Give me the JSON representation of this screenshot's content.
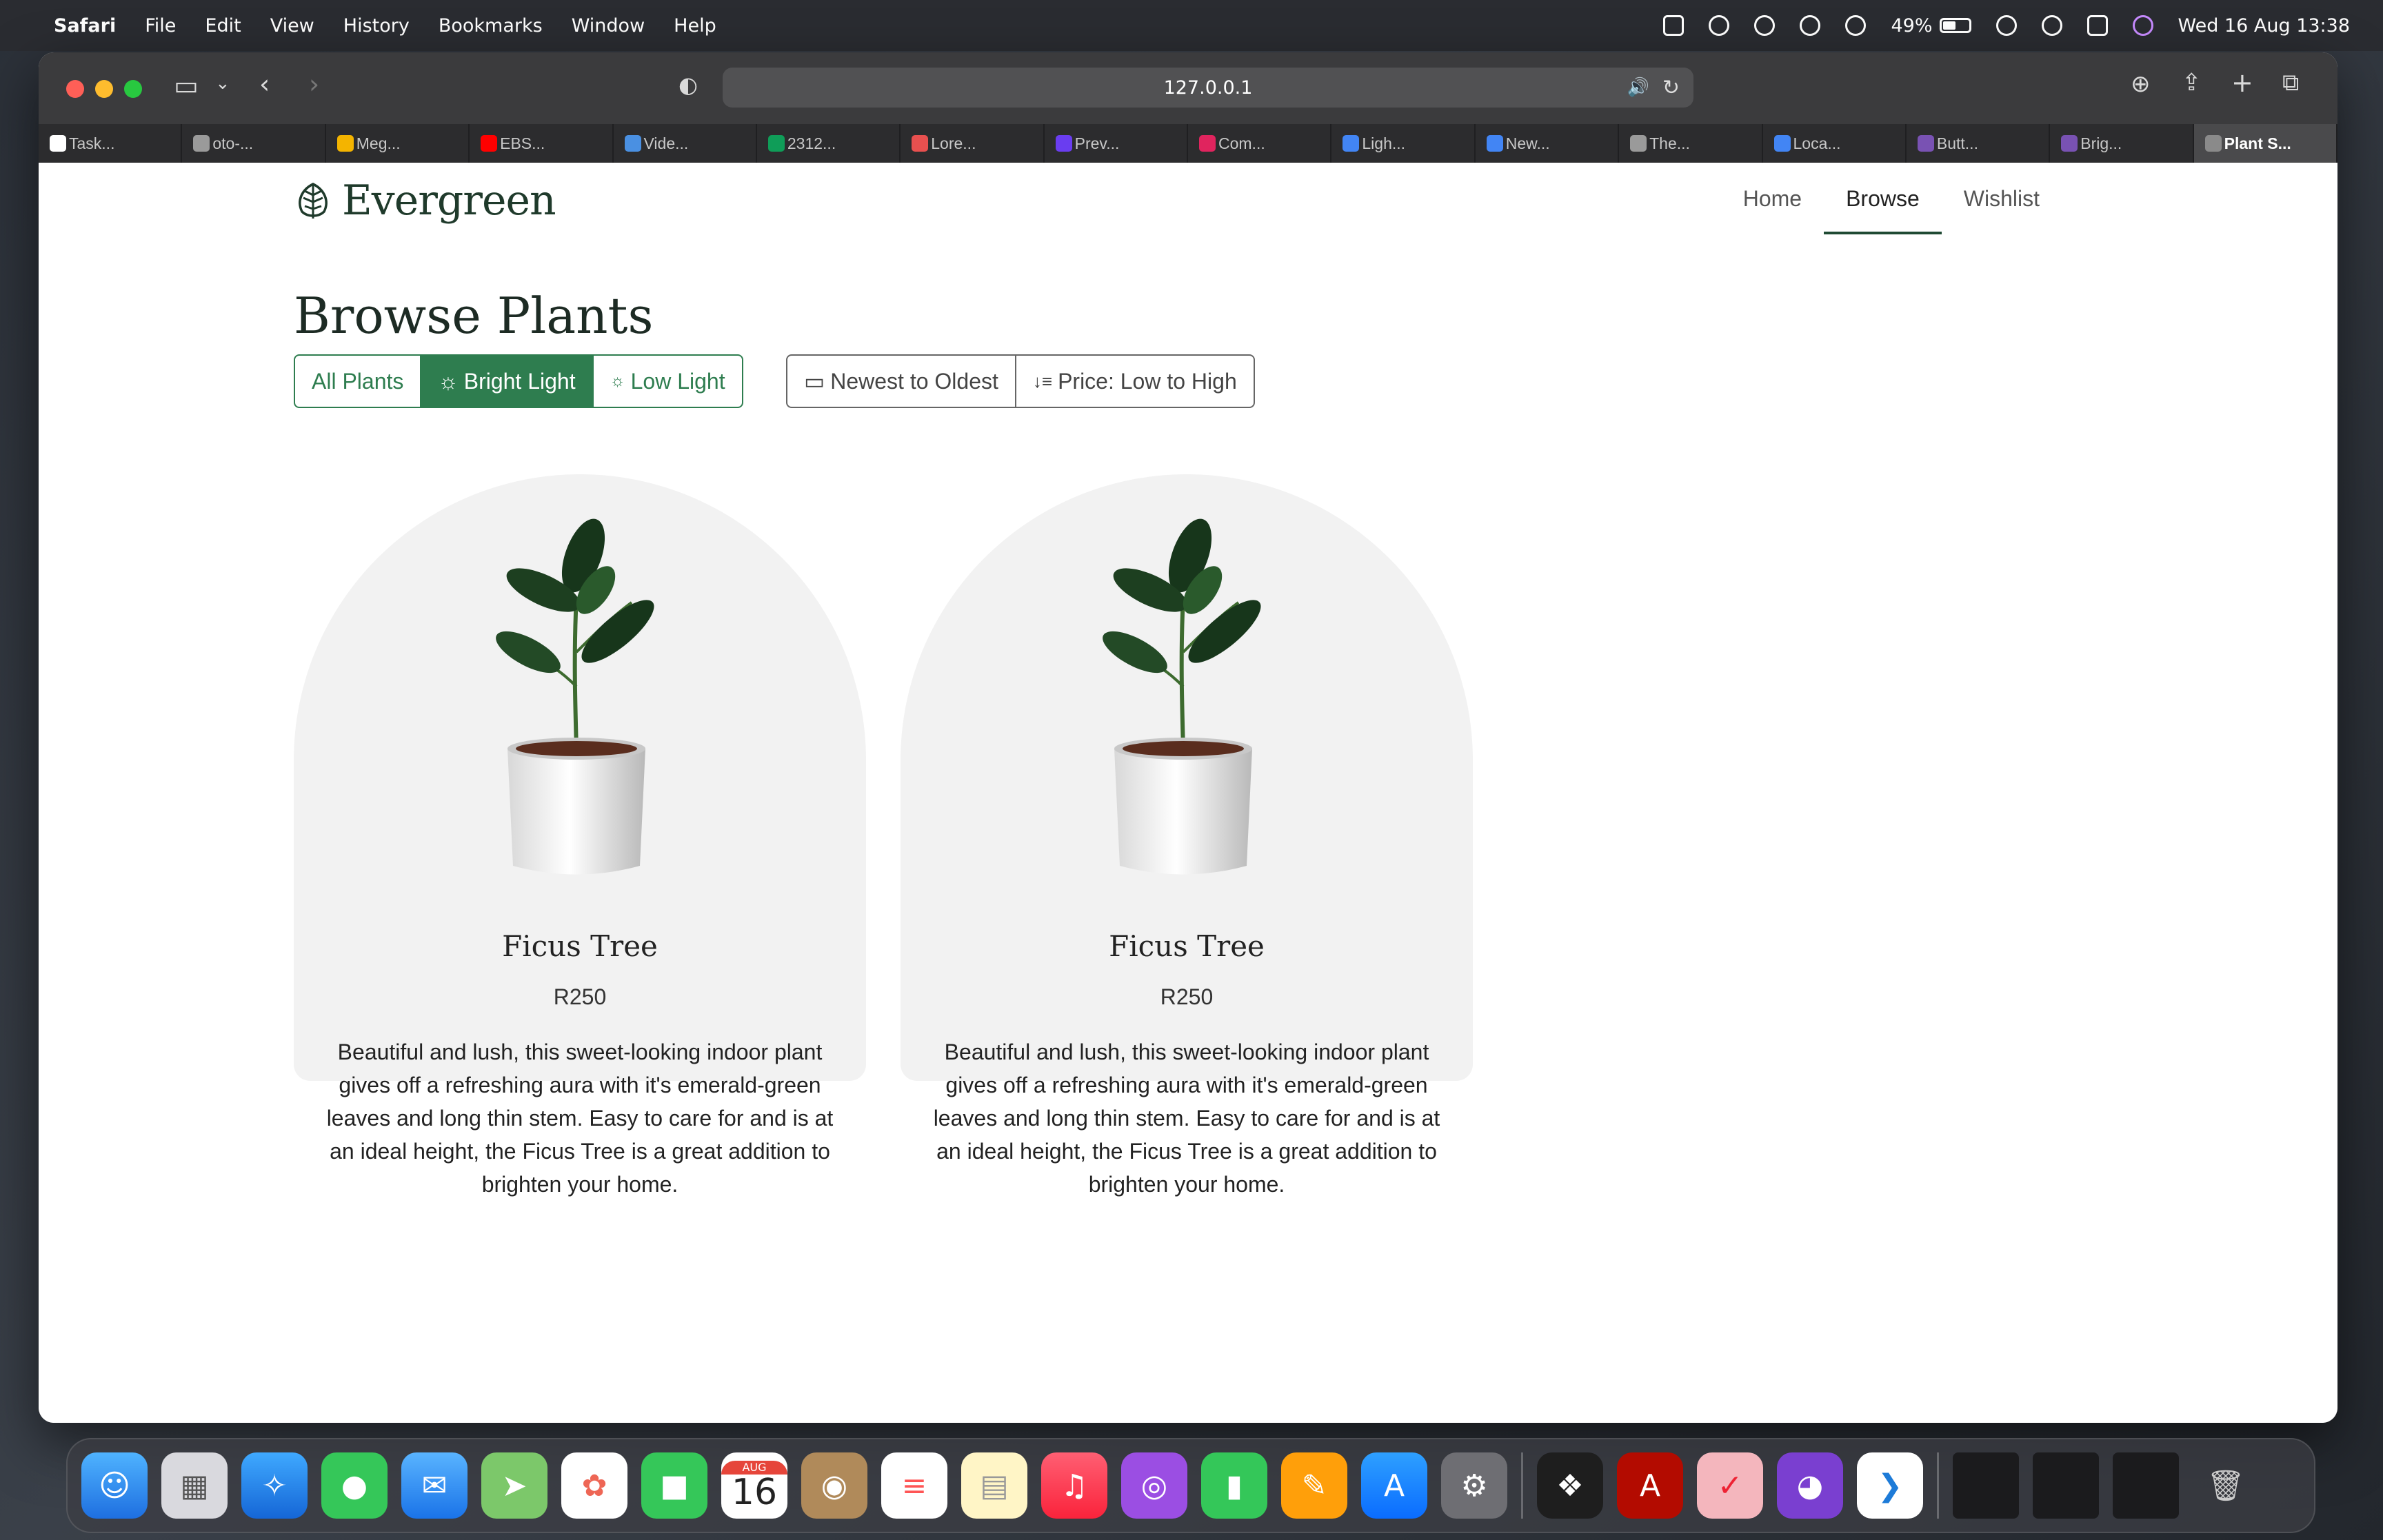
{
  "menubar": {
    "app": "Safari",
    "items": [
      "File",
      "Edit",
      "View",
      "History",
      "Bookmarks",
      "Window",
      "Help"
    ],
    "battery": "49%",
    "clock": "Wed 16 Aug  13:38"
  },
  "browser": {
    "url": "127.0.0.1",
    "tabs": [
      {
        "label": "Task...",
        "color": "#ffffff"
      },
      {
        "label": "oto-...",
        "color": "#9a9a9a"
      },
      {
        "label": "Meg...",
        "color": "#f4b400"
      },
      {
        "label": "EBS...",
        "color": "#ff0000"
      },
      {
        "label": "Vide...",
        "color": "#4a90e2"
      },
      {
        "label": "2312...",
        "color": "#0f9d58"
      },
      {
        "label": "Lore...",
        "color": "#e8504f"
      },
      {
        "label": "Prev...",
        "color": "#6a3df0"
      },
      {
        "label": "Com...",
        "color": "#e0245e"
      },
      {
        "label": "Ligh...",
        "color": "#4285f4"
      },
      {
        "label": "New...",
        "color": "#4285f4"
      },
      {
        "label": "The...",
        "color": "#9a9a9a"
      },
      {
        "label": "Loca...",
        "color": "#4285f4"
      },
      {
        "label": "Butt...",
        "color": "#7952b3"
      },
      {
        "label": "Brig...",
        "color": "#7952b3"
      },
      {
        "label": "Plant S...",
        "color": "#8a8a8a"
      }
    ]
  },
  "site": {
    "brand": "Evergreen",
    "nav": [
      "Home",
      "Browse",
      "Wishlist"
    ],
    "active_nav": "Browse",
    "title": "Browse Plants",
    "light_filters": [
      "All Plants",
      "Bright Light",
      "Low Light"
    ],
    "active_filter": "Bright Light",
    "sort_options": [
      "Newest to Oldest",
      "Price: Low to High"
    ],
    "accent": "#2e7d4f"
  },
  "products": [
    {
      "name": "Ficus Tree",
      "price": "R250",
      "description": "Beautiful and lush, this sweet-looking indoor plant gives off a refreshing aura with it's emerald-green leaves and long thin stem. Easy to care for and is at an ideal height, the Ficus Tree is a great addition to brighten your home."
    },
    {
      "name": "Ficus Tree",
      "price": "R250",
      "description": "Beautiful and lush, this sweet-looking indoor plant gives off a refreshing aura with it's emerald-green leaves and long thin stem. Easy to care for and is at an ideal height, the Ficus Tree is a great addition to brighten your home."
    }
  ],
  "dock": {
    "apps": [
      "finder",
      "launchpad",
      "safari",
      "messages",
      "mail",
      "maps",
      "photos",
      "facetime",
      "calendar",
      "contacts",
      "reminders",
      "notes",
      "music",
      "podcasts",
      "numbers",
      "pages",
      "app-store",
      "system-settings",
      "figma",
      "acrobat",
      "tasks",
      "github-desktop",
      "vscode"
    ],
    "calendar_month": "AUG",
    "calendar_day": "16"
  }
}
